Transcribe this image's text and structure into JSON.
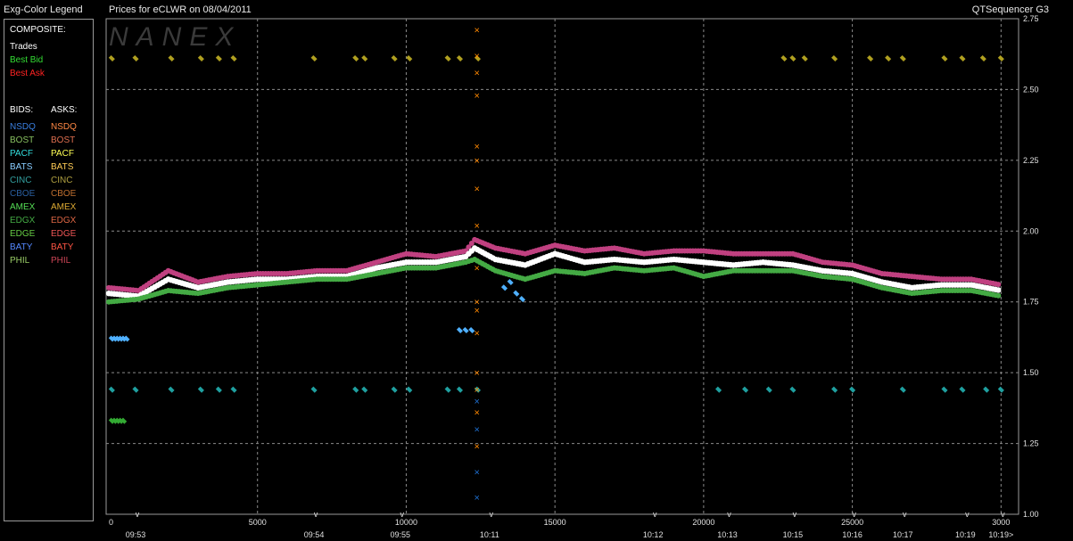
{
  "header": {
    "legend_title": "Exg-Color Legend",
    "chart_title": "Prices for  eCLWR  on  08/04/2011",
    "app_name": "QTSequencer G3"
  },
  "legend": {
    "composite_label": "COMPOSITE:",
    "composite": [
      {
        "label": "Trades",
        "color": "#ffffff"
      },
      {
        "label": "Best Bid",
        "color": "#33dd33"
      },
      {
        "label": "Best Ask",
        "color": "#ff2222"
      }
    ],
    "bids_label": "BIDS:",
    "asks_label": "ASKS:",
    "exchanges": [
      {
        "bid": "NSDQ",
        "bid_color": "#3a7fe0",
        "ask": "NSDQ",
        "ask_color": "#ff8844"
      },
      {
        "bid": "BOST",
        "bid_color": "#88c060",
        "ask": "BOST",
        "ask_color": "#e07050"
      },
      {
        "bid": "PACF",
        "bid_color": "#33dddd",
        "ask": "PACF",
        "ask_color": "#ffff55"
      },
      {
        "bid": "BATS",
        "bid_color": "#88ccff",
        "ask": "BATS",
        "ask_color": "#ffcc55"
      },
      {
        "bid": "CINC",
        "bid_color": "#33a0a0",
        "ask": "CINC",
        "ask_color": "#b0a040"
      },
      {
        "bid": "CBOE",
        "bid_color": "#2a5fa0",
        "ask": "CBOE",
        "ask_color": "#c07030"
      },
      {
        "bid": "AMEX",
        "bid_color": "#55dd55",
        "ask": "AMEX",
        "ask_color": "#ddaa33"
      },
      {
        "bid": "EDGX",
        "bid_color": "#44aa44",
        "ask": "EDGX",
        "ask_color": "#dd6644"
      },
      {
        "bid": "EDGE",
        "bid_color": "#66cc44",
        "ask": "EDGE",
        "ask_color": "#ee5555"
      },
      {
        "bid": "BATY",
        "bid_color": "#5588ff",
        "ask": "BATY",
        "ask_color": "#ff5544"
      },
      {
        "bid": "PHIL",
        "bid_color": "#99cc66",
        "ask": "PHIL",
        "ask_color": "#cc4455"
      }
    ]
  },
  "watermark": "NANEX",
  "chart_data": {
    "type": "scatter",
    "title": "Prices for  eCLWR  on  08/04/2011",
    "ylim": [
      1.0,
      2.75
    ],
    "yticks": [
      "2.75",
      "2.50",
      "2.25",
      "2.00",
      "1.75",
      "1.50",
      "1.25",
      "1.00"
    ],
    "ytick_values": [
      2.75,
      2.5,
      2.25,
      2.0,
      1.75,
      1.5,
      1.25,
      1.0
    ],
    "xlim": [
      0,
      30500
    ],
    "xticks": [
      "0",
      "5000",
      "10000",
      "15000",
      "20000",
      "25000",
      "3000"
    ],
    "xtick_values": [
      0,
      5000,
      10000,
      15000,
      20000,
      25000,
      30000
    ],
    "time_labels": [
      "09:53",
      "09:54",
      "09:55",
      "10:11",
      "10:12",
      "10:13",
      "10:15",
      "10:16",
      "10:17",
      "10:19",
      "10:19>"
    ],
    "time_label_positions": [
      900,
      6900,
      9800,
      12800,
      18300,
      20800,
      23000,
      25000,
      26700,
      28800,
      30000
    ],
    "grid": true,
    "series": [
      {
        "name": "Best Ask",
        "color": "#c04080",
        "x": [
          0,
          1000,
          2000,
          3000,
          4000,
          5000,
          6000,
          7000,
          8000,
          9000,
          10000,
          11000,
          12000,
          12300,
          13000,
          14000,
          15000,
          16000,
          17000,
          18000,
          19000,
          20000,
          21000,
          22000,
          23000,
          24000,
          25000,
          26000,
          27000,
          28000,
          29000,
          30000
        ],
        "y": [
          1.8,
          1.79,
          1.86,
          1.82,
          1.84,
          1.85,
          1.85,
          1.86,
          1.86,
          1.89,
          1.92,
          1.91,
          1.93,
          1.97,
          1.94,
          1.92,
          1.95,
          1.93,
          1.94,
          1.92,
          1.93,
          1.93,
          1.92,
          1.92,
          1.92,
          1.89,
          1.88,
          1.85,
          1.84,
          1.83,
          1.83,
          1.81
        ]
      },
      {
        "name": "Trades",
        "color": "#ffffff",
        "x": [
          0,
          1000,
          2000,
          3000,
          4000,
          5000,
          6000,
          7000,
          8000,
          9000,
          10000,
          11000,
          12000,
          12300,
          13000,
          14000,
          15000,
          16000,
          17000,
          18000,
          19000,
          20000,
          21000,
          22000,
          23000,
          24000,
          25000,
          26000,
          27000,
          28000,
          29000,
          30000
        ],
        "y": [
          1.78,
          1.77,
          1.83,
          1.8,
          1.82,
          1.83,
          1.83,
          1.84,
          1.84,
          1.87,
          1.89,
          1.89,
          1.91,
          1.94,
          1.9,
          1.88,
          1.92,
          1.89,
          1.9,
          1.89,
          1.9,
          1.89,
          1.88,
          1.89,
          1.88,
          1.86,
          1.85,
          1.82,
          1.8,
          1.81,
          1.81,
          1.79
        ]
      },
      {
        "name": "Best Bid",
        "color": "#44aa44",
        "x": [
          0,
          1000,
          2000,
          3000,
          4000,
          5000,
          6000,
          7000,
          8000,
          9000,
          10000,
          11000,
          12000,
          12300,
          13000,
          14000,
          15000,
          16000,
          17000,
          18000,
          19000,
          20000,
          21000,
          22000,
          23000,
          24000,
          25000,
          26000,
          27000,
          28000,
          29000,
          30000
        ],
        "y": [
          1.75,
          1.76,
          1.79,
          1.78,
          1.8,
          1.81,
          1.82,
          1.83,
          1.83,
          1.85,
          1.87,
          1.87,
          1.89,
          1.9,
          1.86,
          1.83,
          1.86,
          1.85,
          1.87,
          1.86,
          1.87,
          1.84,
          1.86,
          1.86,
          1.86,
          1.84,
          1.83,
          1.8,
          1.78,
          1.79,
          1.79,
          1.77
        ]
      },
      {
        "name": "AMEX",
        "color": "#b0a020",
        "x": [
          100,
          900,
          2100,
          3100,
          3700,
          4200,
          6900,
          8300,
          8600,
          9600,
          10100,
          11400,
          11800,
          12400,
          22700,
          23000,
          23400,
          24400,
          25600,
          26200,
          26700,
          28100,
          28700,
          29400,
          30000
        ],
        "y": [
          2.61,
          2.61,
          2.61,
          2.61,
          2.61,
          2.61,
          2.61,
          2.61,
          2.61,
          2.61,
          2.61,
          2.61,
          2.61,
          2.61,
          2.61,
          2.61,
          2.61,
          2.61,
          2.61,
          2.61,
          2.61,
          2.61,
          2.61,
          2.61,
          2.61
        ]
      },
      {
        "name": "CINC",
        "color": "#1fa0a0",
        "x": [
          100,
          900,
          2100,
          3100,
          3700,
          4200,
          6900,
          8300,
          8600,
          9600,
          10100,
          11400,
          11800,
          12400,
          20500,
          21400,
          22200,
          23000,
          24400,
          25000,
          26700,
          28100,
          28700,
          29500,
          30000
        ],
        "y": [
          1.44,
          1.44,
          1.44,
          1.44,
          1.44,
          1.44,
          1.44,
          1.44,
          1.44,
          1.44,
          1.44,
          1.44,
          1.44,
          1.44,
          1.44,
          1.44,
          1.44,
          1.44,
          1.44,
          1.44,
          1.44,
          1.44,
          1.44,
          1.44,
          1.44
        ]
      },
      {
        "name": "BATS",
        "color": "#4fb0ff",
        "x": [
          100,
          200,
          300,
          400,
          500,
          600,
          11800,
          12000,
          12200,
          13300,
          13500,
          13700,
          13900
        ],
        "y": [
          1.62,
          1.62,
          1.62,
          1.62,
          1.62,
          1.62,
          1.65,
          1.65,
          1.65,
          1.8,
          1.82,
          1.78,
          1.76
        ]
      },
      {
        "name": "PACF",
        "color": "#33aa33",
        "x": [
          100,
          200,
          300,
          400,
          500
        ],
        "y": [
          1.33,
          1.33,
          1.33,
          1.33,
          1.33
        ]
      },
      {
        "name": "Spike",
        "color": "#ff8800",
        "x": [
          12400,
          12400,
          12400,
          12400,
          12400,
          12400,
          12400,
          12400,
          12400,
          12400,
          12400,
          12400,
          12400,
          12400,
          12400,
          12400
        ],
        "y": [
          2.71,
          2.62,
          2.56,
          2.48,
          2.3,
          2.25,
          2.15,
          2.02,
          1.87,
          1.75,
          1.72,
          1.64,
          1.5,
          1.44,
          1.36,
          1.24
        ]
      },
      {
        "name": "Spike-low",
        "color": "#1e6fd0",
        "x": [
          12400,
          12400,
          12400,
          12400
        ],
        "y": [
          1.4,
          1.3,
          1.15,
          1.06
        ]
      }
    ]
  }
}
